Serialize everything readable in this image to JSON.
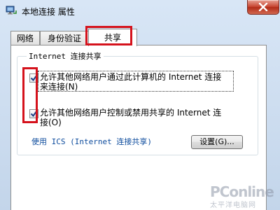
{
  "window": {
    "title": "本地连接 属性"
  },
  "tabs": [
    {
      "label": "网络"
    },
    {
      "label": "身份验证"
    },
    {
      "label": "共享"
    }
  ],
  "group": {
    "title": "Internet 连接共享"
  },
  "options": [
    {
      "line1": "允许其他网络用户通过此计算机的 Internet 连接",
      "line2": "来连接(N)",
      "checked": true
    },
    {
      "line1": "允许其他网络用户控制或禁用共享的 Internet 连",
      "line2": "接(O)",
      "checked": true
    }
  ],
  "link": {
    "label": "使用 ICS (Internet 连接共享)"
  },
  "buttons": {
    "settings": "设置(G)..."
  },
  "watermark": {
    "brand": "PConline",
    "sub": "太平洋电脑网"
  },
  "colors": {
    "highlight": "#d5121c",
    "link": "#0b4a9c",
    "close": "#c74632"
  },
  "icons": [
    "network-connection-icon",
    "close-icon",
    "checkmark-icon"
  ]
}
